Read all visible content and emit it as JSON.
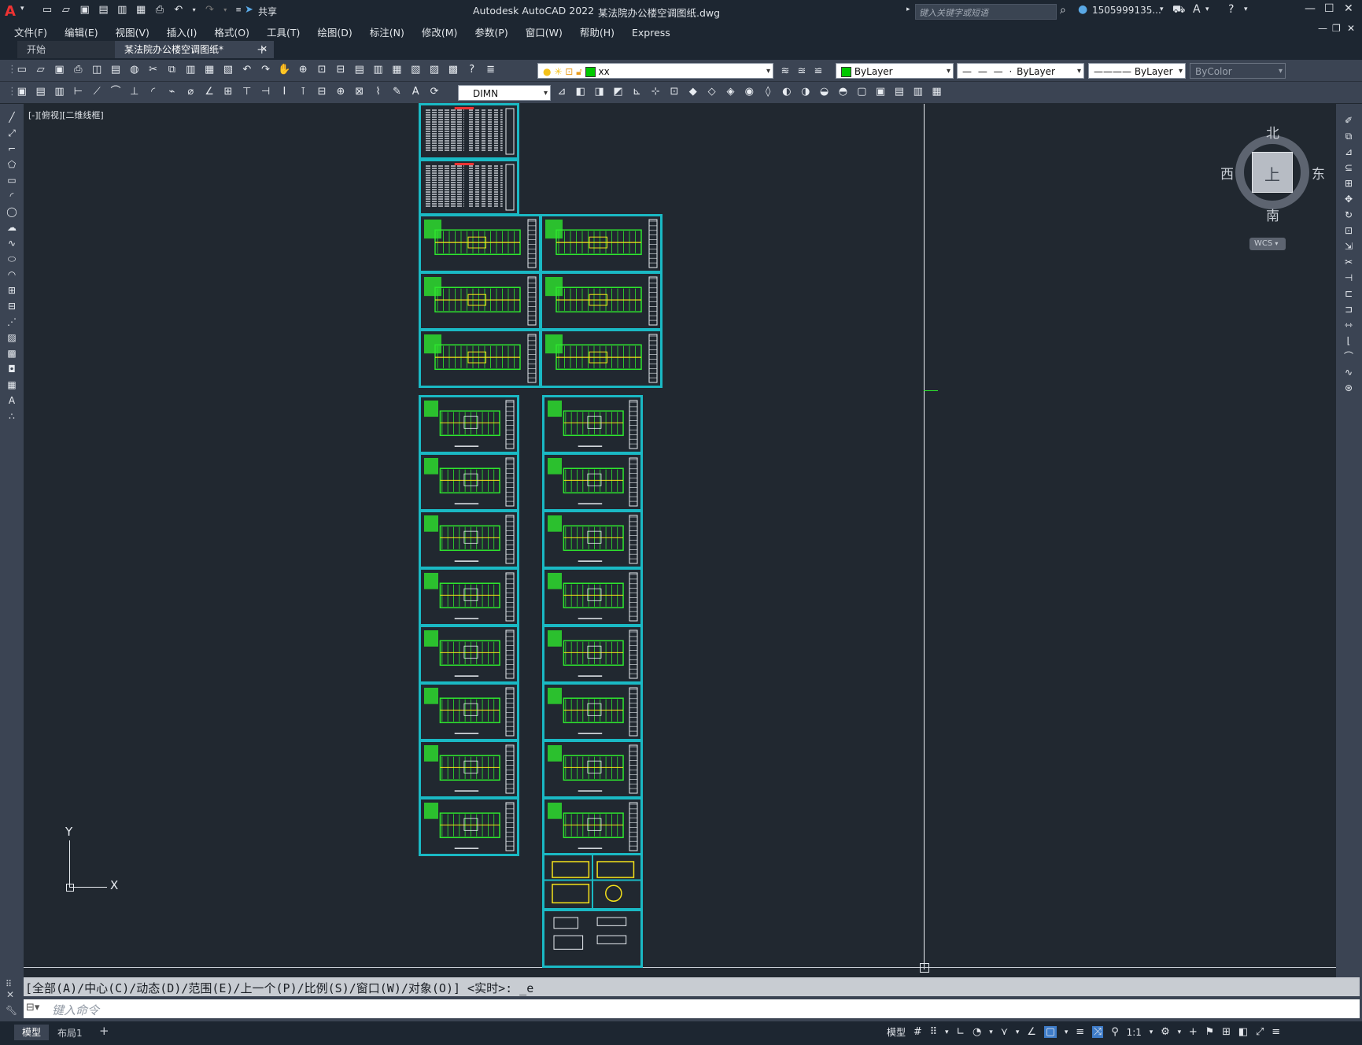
{
  "title_bar": {
    "app_title": "Autodesk AutoCAD 2022",
    "file_name": "某法院办公楼空调图纸.dwg",
    "share_label": "共享",
    "search_placeholder": "键入关键字或短语",
    "user_id": "1505999135..."
  },
  "menu": [
    "文件(F)",
    "编辑(E)",
    "视图(V)",
    "插入(I)",
    "格式(O)",
    "工具(T)",
    "绘图(D)",
    "标注(N)",
    "修改(M)",
    "参数(P)",
    "窗口(W)",
    "帮助(H)",
    "Express"
  ],
  "tabs": [
    {
      "label": "开始",
      "active": false
    },
    {
      "label": "某法院办公楼空调图纸*",
      "active": true
    }
  ],
  "toolbar": {
    "layer_name": "xx",
    "color": "ByLayer",
    "linetype": "ByLayer",
    "lineweight": "ByLayer",
    "plotstyle": "ByColor",
    "dimstyle": "DIMN"
  },
  "viewport": {
    "label": "[-][俯视][二维线框]",
    "viewcube": {
      "north": "北",
      "south": "南",
      "east": "东",
      "west": "西",
      "face": "上",
      "wcs": "WCS"
    },
    "ucs": {
      "x": "X",
      "y": "Y"
    }
  },
  "command": {
    "history": "[全部(A)/中心(C)/动态(D)/范围(E)/上一个(P)/比例(S)/窗口(W)/对象(O)] <实时>: _e",
    "placeholder": "键入命令"
  },
  "status": {
    "model_tab": "模型",
    "layout_tab": "布局1",
    "model_label": "模型",
    "scale": "1:1"
  },
  "colors": {
    "sheet_border": "#1ab9c4",
    "drawing_green": "#2ee62e",
    "drawing_yellow": "#f5e21a",
    "layer_swatch": "#00c800"
  }
}
